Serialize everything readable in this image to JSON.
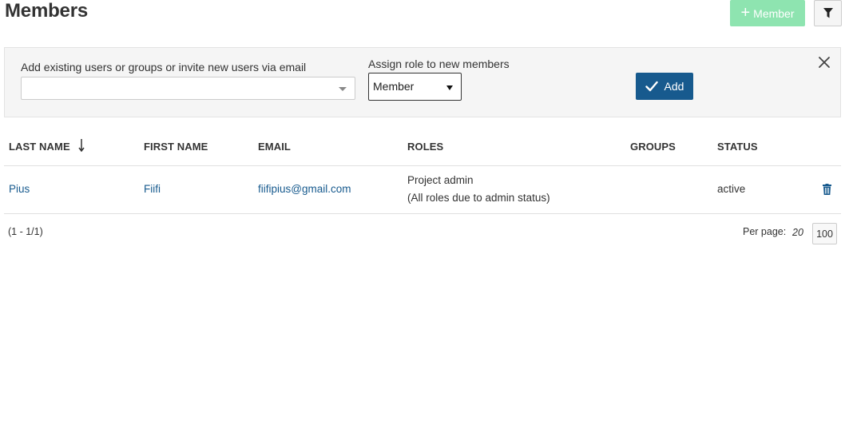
{
  "page": {
    "title": "Members"
  },
  "toolbar": {
    "add_member_label": "Member",
    "add_member_icon": "plus-icon",
    "filter_icon": "filter-icon",
    "add_member_color": "#8ee4b0"
  },
  "invite": {
    "users_label": "Add existing users or groups or invite new users via email",
    "users_value": "",
    "role_label": "Assign role to new members",
    "role_selected": "Member",
    "add_label": "Add",
    "add_color": "#175a8e",
    "close_icon": "close-icon"
  },
  "table": {
    "columns": [
      "LAST NAME",
      "FIRST NAME",
      "EMAIL",
      "ROLES",
      "GROUPS",
      "STATUS"
    ],
    "sort_icon": "sort-descending-icon",
    "rows": [
      {
        "last_name": "Pius",
        "first_name": "Fiifi",
        "email": "fiifipius@gmail.com",
        "role": "Project admin",
        "role_note": "(All roles due to admin status)",
        "groups": "",
        "status": "active",
        "delete_icon": "trash-icon"
      }
    ]
  },
  "pagination": {
    "range": "(1 - 1/1)",
    "per_page_label": "Per page:",
    "options": [
      "20",
      "100"
    ],
    "selected": "100"
  },
  "colors": {
    "link": "#175a8e",
    "panel_bg": "#f5f5f5"
  }
}
